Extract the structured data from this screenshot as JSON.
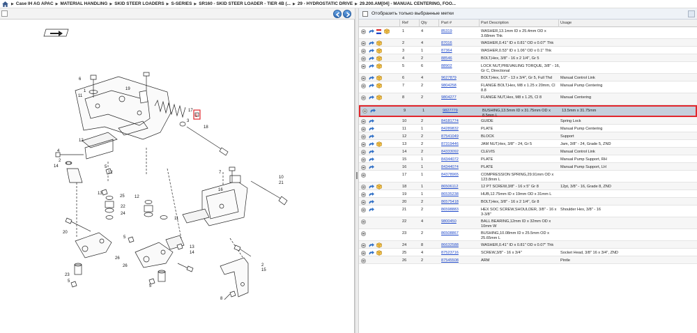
{
  "breadcrumb": {
    "items": [
      "Case IH AG APAC",
      "MATERIAL HANDLING",
      "SKID STEER LOADERS",
      "S-SERIES",
      "SR160 - SKID STEER LOADER - TIER 4B (...",
      "29 - HYDROSTATIC DRIVE",
      "29.200.AM[04] - MANUAL CENTERING, FOO..."
    ]
  },
  "filter": {
    "label": "Отобразить только выбранные метки"
  },
  "grid": {
    "headers": {
      "ref": "Ref",
      "qty": "Qty",
      "part": "Part #",
      "desc": "Part Description",
      "usage": "Usage"
    },
    "rows": [
      {
        "ref": "1",
        "qty": "4",
        "part": "85319",
        "desc": "WASHER,13.1mm ID x 25.4mm OD x 3.68mm Thk",
        "usage": "",
        "icons": "arrow-flag-pkg"
      },
      {
        "ref": "2",
        "qty": "4",
        "part": "87016",
        "desc": "WASHER,0.41\" ID x 0.81\" OD x 0.07\" Thk",
        "usage": "",
        "icons": "arrow-pkg"
      },
      {
        "ref": "3",
        "qty": "1",
        "part": "87364",
        "desc": "WASHER,0.53\" ID x 1.06\" OD x 0.1\" Thk",
        "usage": "",
        "icons": "arrow-pkg"
      },
      {
        "ref": "4",
        "qty": "2",
        "part": "88546",
        "desc": "BOLT,Hex, 3/8\" - 16 x 2 1/4\", Gr 5",
        "usage": "",
        "icons": "arrow-pkg"
      },
      {
        "ref": "5",
        "qty": "6",
        "part": "88902",
        "desc": "LOCK NUT,PREVAILING TORQUE, 3/8\" - 16, Gr C, Directional",
        "usage": "",
        "icons": "arrow-pkg"
      },
      {
        "ref": "6",
        "qty": "4",
        "part": "9627879",
        "desc": "BOLT,Hex, 1/2\" - 13 x 3/4\", Gr 5, Full Thd",
        "usage": "Manual Control Link",
        "icons": "arrow-pkg"
      },
      {
        "ref": "7",
        "qty": "2",
        "part": "9804258",
        "desc": "FLANGE BOLT,Hex, M8 x 1.25 x 20mm, Cl 8.8",
        "usage": "Manual Pump Centering",
        "icons": "arrow-pkg"
      },
      {
        "ref": "8",
        "qty": "2",
        "part": "9804277",
        "desc": "FLANGE NUT,Hex, M8 x 1.25, Cl 8",
        "usage": "Manual Centering",
        "icons": "arrow-pkg"
      },
      {
        "ref": "9",
        "qty": "1",
        "part": "9827779",
        "desc": "BUSHING,13.5mm ID x 31.75mm OD x 8.5mm L",
        "usage": "13.5mm x 31.75mm",
        "icons": "arrow",
        "selected": true
      },
      {
        "ref": "10",
        "qty": "2",
        "part": "84181774",
        "desc": "GUIDE",
        "usage": "Spring Lock",
        "icons": "arrow"
      },
      {
        "ref": "11",
        "qty": "1",
        "part": "84289832",
        "desc": "PLATE",
        "usage": "Manual Pump Centering",
        "icons": "arrow"
      },
      {
        "ref": "12",
        "qty": "2",
        "part": "87541049",
        "desc": "BLOCK",
        "usage": "Support",
        "icons": "arrow"
      },
      {
        "ref": "13",
        "qty": "2",
        "part": "87319446",
        "desc": "JAM NUT,Hex, 3/8\" - 24, Gr 5",
        "usage": "Jam, 3/8\" - 24, Grade 5, ZND",
        "icons": "arrow-pkg"
      },
      {
        "ref": "14",
        "qty": "2",
        "part": "84333092",
        "desc": "CLEVIS",
        "usage": "Manual Control Link",
        "icons": "arrow"
      },
      {
        "ref": "15",
        "qty": "1",
        "part": "84344072",
        "desc": "PLATE",
        "usage": "Manual Pump Support, RH",
        "icons": "arrow"
      },
      {
        "ref": "16",
        "qty": "1",
        "part": "84344074",
        "desc": "PLATE",
        "usage": "Manual Pump Support, LH",
        "icons": "arrow"
      },
      {
        "ref": "17",
        "qty": "1",
        "part": "84378965",
        "desc": "COMPRESSION SPRING,29.91mm OD x 123.8mm L",
        "usage": "",
        "icons": ""
      },
      {
        "ref": "18",
        "qty": "1",
        "part": "86506112",
        "desc": "12 PT SCREW,3/8\" - 16 x 5\" Gr 8",
        "usage": "12pt, 3/8\" - 16, Grade 8, ZND",
        "icons": "arrow-pkg"
      },
      {
        "ref": "19",
        "qty": "1",
        "part": "86535238",
        "desc": "HUB,12.75mm ID x 19mm OD x 31mm L",
        "usage": "",
        "icons": "arrow"
      },
      {
        "ref": "20",
        "qty": "2",
        "part": "86575418",
        "desc": "BOLT,Hex, 3/8\" - 16 x 2 1/4\", Gr 8",
        "usage": "",
        "icons": "arrow"
      },
      {
        "ref": "21",
        "qty": "2",
        "part": "86598883",
        "desc": "HEX SOC SCREW,SHOULDER, 3/8\" - 16 x 3-3/8\"",
        "usage": "Shoulder Hex, 3/8\" - 16",
        "icons": "arrow"
      },
      {
        "ref": "22",
        "qty": "4",
        "part": "9800450",
        "desc": "BALL BEARING,12mm ID x 32mm OD x 10mm W",
        "usage": "",
        "icons": ""
      },
      {
        "ref": "23",
        "qty": "2",
        "part": "86508867",
        "desc": "BUSHING,10.08mm ID x 25.5mm OD x 25.65mm L",
        "usage": "",
        "icons": ""
      },
      {
        "ref": "24",
        "qty": "8",
        "part": "86632588",
        "desc": "WASHER,0.41\" ID x 0.81\" OD x 0.07\" Thk",
        "usage": "",
        "icons": "arrow-pkg"
      },
      {
        "ref": "25",
        "qty": "4",
        "part": "87523716",
        "desc": "SCREW,3/8\" - 16 x 3/4\"",
        "usage": "Socket Head, 3/8\" 16 x 3/4\", ZND",
        "icons": "arrow-pkg"
      },
      {
        "ref": "26",
        "qty": "2",
        "part": "87545508",
        "desc": "ARM",
        "usage": "Pintle",
        "icons": ""
      }
    ]
  },
  "diagram": {
    "callouts": [
      "6",
      "1",
      "11",
      "19",
      "17",
      "9",
      "3",
      "18",
      "12",
      "4",
      "2",
      "14",
      "5",
      "12",
      "7",
      "10",
      "21",
      "16",
      "13",
      "25",
      "22",
      "24",
      "12",
      "20",
      "5",
      "26",
      "15",
      "26",
      "23",
      "5",
      "11",
      "14",
      "13",
      "2",
      "8",
      "5"
    ]
  },
  "colors": {
    "selected_border": "#e1262c",
    "selected_bg": "#c5cfdc",
    "link": "#1d47c9"
  }
}
